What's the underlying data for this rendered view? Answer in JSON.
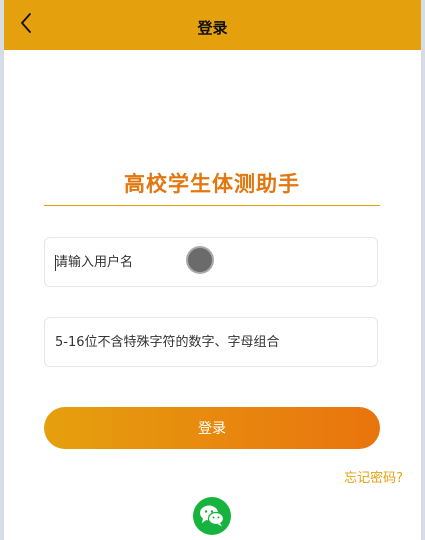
{
  "nav": {
    "back_icon": "chevron-left-icon",
    "title": "登录"
  },
  "app": {
    "title": "高校学生体测助手"
  },
  "form": {
    "username": {
      "value": "",
      "placeholder": "请输入用户名"
    },
    "password": {
      "value": "",
      "placeholder": "5-16位不含特殊字符的数字、字母组合"
    },
    "login_label": "登录",
    "forgot_label": "忘记密码?"
  },
  "social": {
    "wechat_icon": "wechat-icon"
  },
  "colors": {
    "brand": "#e5a00d",
    "accent": "#e0770f",
    "wechat": "#16b33f"
  }
}
